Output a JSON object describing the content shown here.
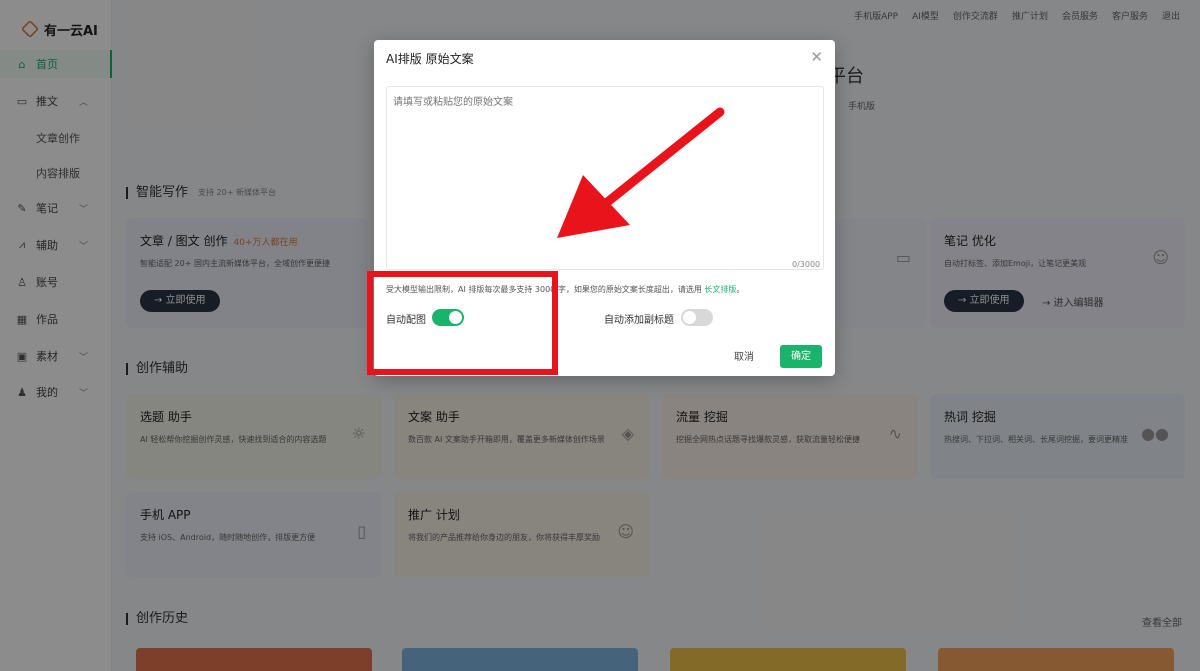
{
  "brand": {
    "logo_text": "有一云AI"
  },
  "topbar": [
    "手机版APP",
    "AI模型",
    "创作交流群",
    "推广计划",
    "会员服务",
    "客户服务",
    "退出"
  ],
  "sidebar": {
    "items": [
      {
        "label": "首页",
        "icon": "home-icon"
      },
      {
        "label": "推文",
        "icon": "doc-icon"
      },
      {
        "label": "笔记",
        "icon": "note-icon"
      },
      {
        "label": "辅助",
        "icon": "chart-icon"
      },
      {
        "label": "账号",
        "icon": "user-icon"
      },
      {
        "label": "作品",
        "icon": "grid-icon"
      },
      {
        "label": "素材",
        "icon": "image-icon"
      },
      {
        "label": "我的",
        "icon": "person-icon"
      }
    ],
    "subitems": [
      "文章创作",
      "内容排版"
    ]
  },
  "hero": {
    "title": "平台",
    "mobile": "手机版"
  },
  "sections": {
    "smart_writing": "智能写作",
    "smart_writing_note": "支持 20+ 新媒体平台",
    "assist": "创作辅助",
    "history": "创作历史",
    "history_more": "查看全部"
  },
  "cards": {
    "article": {
      "title": "文章 / 图文 创作",
      "badge": "40+万人都在用",
      "desc": "智能适配 20+ 国内主流新媒体平台，全域创作更便捷",
      "cta": "→ 立即使用"
    },
    "note_opt": {
      "title": "笔记 优化",
      "desc": "自动打标签、添加Emoji，让笔记更美观",
      "cta": "→ 立即使用",
      "cta2": "→ 进入编辑器"
    },
    "topic": {
      "title": "选题 助手",
      "desc": "AI 轻松帮你挖掘创作灵感，快速找到适合的内容选题"
    },
    "copy": {
      "title": "文案 助手",
      "desc": "数百款 AI 文案助手开箱即用，覆盖更多新媒体创作场景"
    },
    "traffic": {
      "title": "流量 挖掘",
      "desc": "挖掘全网热点话题寻找爆款灵感，获取流量轻松便捷"
    },
    "hotword": {
      "title": "热词 挖掘",
      "desc": "热搜词、下拉词、相关词、长尾词挖掘，要词更精准"
    },
    "app": {
      "title": "手机 APP",
      "desc": "支持 iOS、Android，随时随地创作，排版更方便"
    },
    "promo": {
      "title": "推广 计划",
      "desc": "将我们的产品推荐给你身边的朋友，你将获得丰厚奖励"
    }
  },
  "modal": {
    "title": "AI排版 原始文案",
    "placeholder": "请填写或粘贴您的原始文案",
    "counter": "0/3000",
    "notice": "受大模型输出限制，AI 排版每次最多支持 3000 字，如果您的原始文案长度超出，请选用",
    "notice_link": "长文排版",
    "notice_end": "。",
    "toggle_auto_image": {
      "label": "自动配图",
      "on": true
    },
    "toggle_auto_subtitle": {
      "label": "自动添加副标题",
      "on": false
    },
    "cancel": "取消",
    "confirm": "确定"
  },
  "colors": {
    "accent": "#19b36b",
    "annotation": "#e8131b"
  }
}
